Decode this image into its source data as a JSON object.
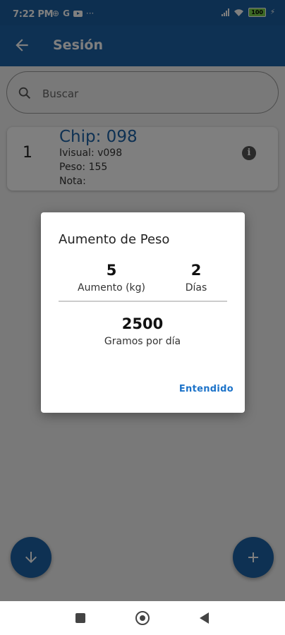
{
  "status_bar": {
    "time": "7:22 PM",
    "g_label": "G",
    "more": "···",
    "battery": "100"
  },
  "app_bar": {
    "title": "Sesión",
    "back_icon": "arrow-back-icon"
  },
  "search": {
    "placeholder": "Buscar",
    "icon": "search-icon"
  },
  "list": [
    {
      "index": "1",
      "chip": "Chip: 098",
      "ivisual": "Ivisual: v098",
      "peso": "Peso: 155",
      "nota": "Nota:"
    }
  ],
  "dialog": {
    "title": "Aumento de Peso",
    "aumento_value": "5",
    "aumento_label": "Aumento (kg)",
    "dias_value": "2",
    "dias_label": "Días",
    "gramos_value": "2500",
    "gramos_label": "Gramos por día",
    "ok_button": "Entendido"
  },
  "fabs": {
    "left_icon": "arrow-down-icon",
    "right_icon": "add-icon"
  },
  "colors": {
    "primary": "#1d62a6",
    "accent_text": "#1d73c9",
    "scrim": "rgba(0,0,0,0.5)"
  }
}
